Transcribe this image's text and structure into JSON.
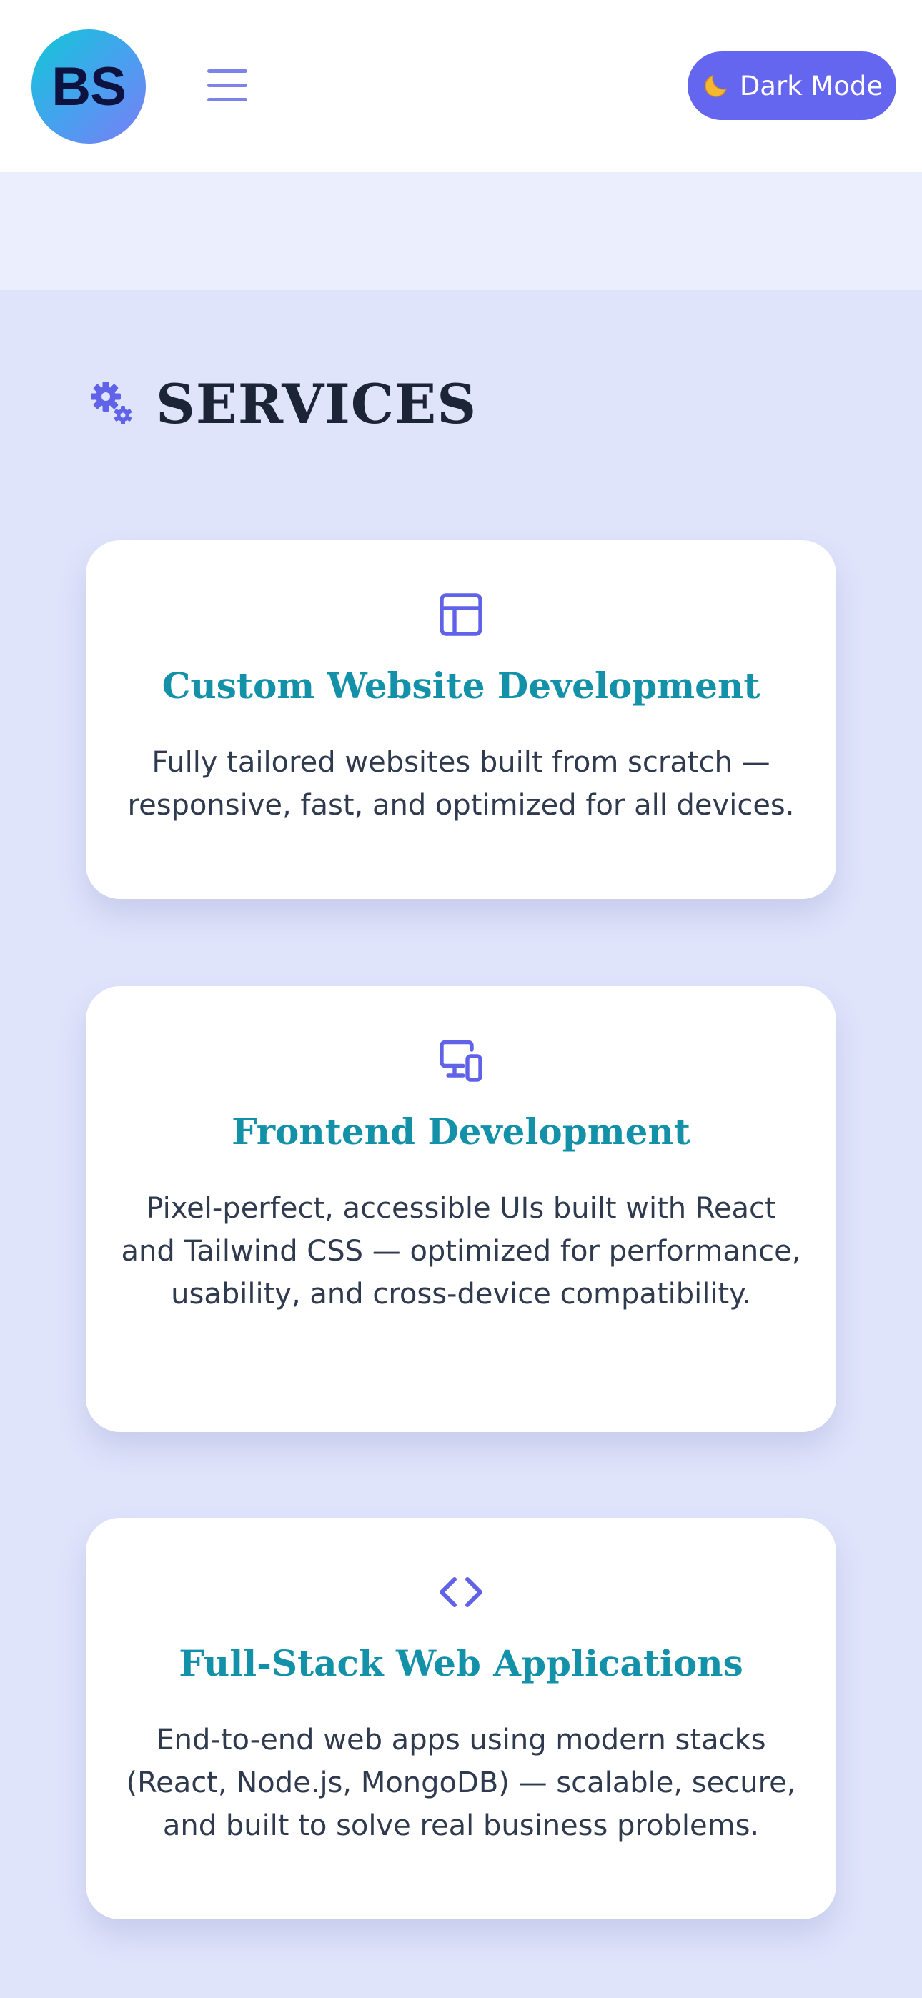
{
  "header": {
    "logo_text": "BS",
    "dark_mode_label": "Dark Mode",
    "accent_color": "#6566f0"
  },
  "services": {
    "title": "SERVICES",
    "items": [
      {
        "icon": "layout-icon",
        "title": "Custom Website Development",
        "description": "Fully tailored websites built from scratch — responsive, fast, and optimized for all devices."
      },
      {
        "icon": "devices-icon",
        "title": "Frontend Development",
        "description": "Pixel-perfect, accessible UIs built with React and Tailwind CSS — optimized for performance, usability, and cross-device compatibility."
      },
      {
        "icon": "code-icon",
        "title": "Full-Stack Web Applications",
        "description": "End-to-end web apps using modern stacks (React, Node.js, MongoDB) — scalable, secure, and built to solve real business problems."
      }
    ]
  }
}
